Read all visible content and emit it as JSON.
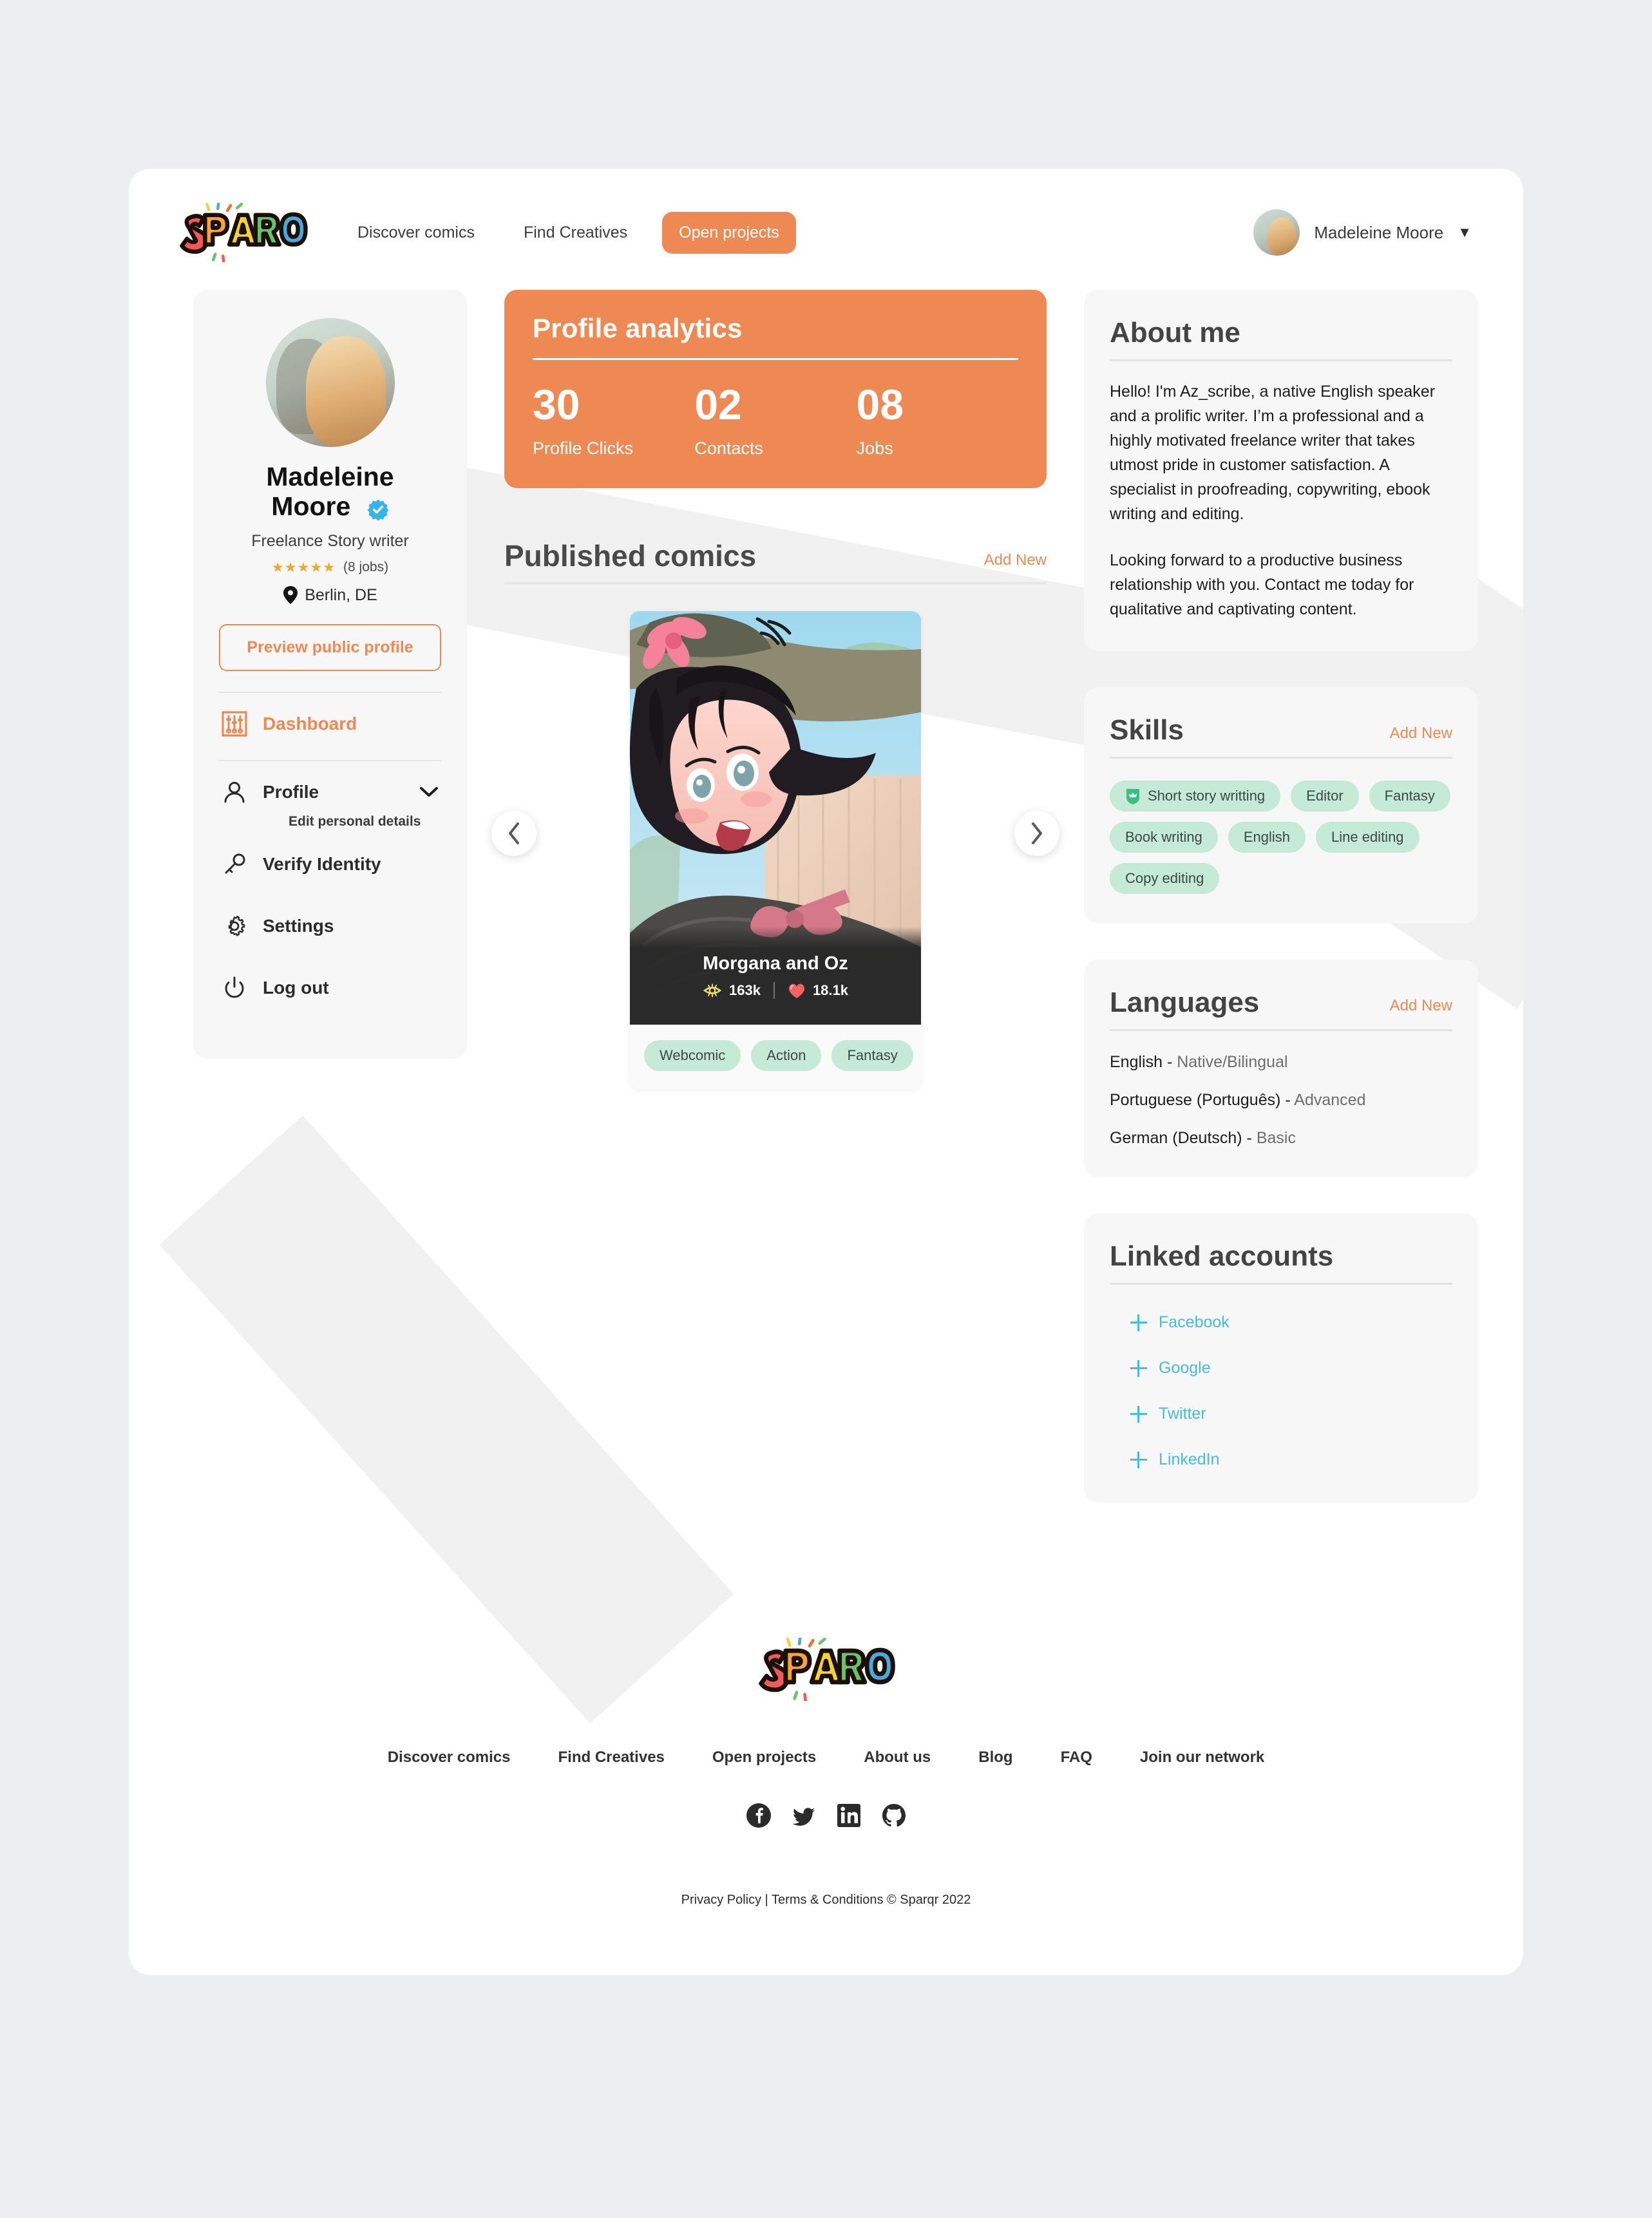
{
  "brand": {
    "name": "Sparqr"
  },
  "header": {
    "nav": [
      {
        "label": "Discover comics",
        "primary": false
      },
      {
        "label": "Find Creatives",
        "primary": false
      },
      {
        "label": "Open projects",
        "primary": true
      }
    ],
    "user": {
      "name": "Madeleine Moore",
      "caret": "▼"
    }
  },
  "sidebar": {
    "profile": {
      "name": "Madeleine Moore",
      "verified": true,
      "role": "Freelance Story writer",
      "stars": "★★★★★",
      "jobs": "(8 jobs)",
      "location": "Berlin, DE"
    },
    "preview_button": "Preview public profile",
    "nav": [
      {
        "label": "Dashboard",
        "icon": "dashboard-icon",
        "active": true
      },
      {
        "label": "Profile",
        "icon": "user-icon",
        "active": false,
        "sub": "Edit personal details",
        "expandable": true
      },
      {
        "label": "Verify Identity",
        "icon": "key-icon",
        "active": false
      },
      {
        "label": "Settings",
        "icon": "gear-icon",
        "active": false
      },
      {
        "label": "Log out",
        "icon": "power-icon",
        "active": false
      }
    ]
  },
  "analytics": {
    "title": "Profile analytics",
    "stats": [
      {
        "value": "30",
        "label": "Profile Clicks"
      },
      {
        "value": "02",
        "label": "Contacts"
      },
      {
        "value": "08",
        "label": "Jobs"
      }
    ]
  },
  "published": {
    "title": "Published comics",
    "add_new": "Add New",
    "prev_label": "‹",
    "next_label": "›",
    "comic": {
      "title": "Morgana and Oz",
      "views": "163k",
      "likes": "18.1k",
      "tags": [
        "Webcomic",
        "Action",
        "Fantasy"
      ]
    }
  },
  "about": {
    "title": "About me",
    "paragraphs": [
      "Hello! I'm Az_scribe, a native English speaker and a prolific writer. I’m a professional and a highly motivated freelance writer that takes utmost pride in customer satisfaction. A specialist in proofreading, copywriting, ebook writing and editing.",
      "Looking forward to a productive business relationship with you. Contact me today for qualitative and captivating content."
    ]
  },
  "skills": {
    "title": "Skills",
    "add_new": "Add New",
    "items": [
      {
        "label": "Short story writting",
        "badge": true
      },
      {
        "label": "Editor",
        "badge": false
      },
      {
        "label": "Fantasy",
        "badge": false
      },
      {
        "label": "Book writing",
        "badge": false
      },
      {
        "label": "English",
        "badge": false
      },
      {
        "label": "Line editing",
        "badge": false
      },
      {
        "label": "Copy editing",
        "badge": false
      }
    ]
  },
  "languages": {
    "title": "Languages",
    "add_new": "Add New",
    "items": [
      {
        "name": "English - ",
        "level": "Native/Bilingual"
      },
      {
        "name": "Portuguese (Português) - ",
        "level": "Advanced"
      },
      {
        "name": "German (Deutsch) - ",
        "level": "Basic"
      }
    ]
  },
  "linked_accounts": {
    "title": "Linked accounts",
    "items": [
      {
        "label": "Facebook"
      },
      {
        "label": "Google"
      },
      {
        "label": "Twitter"
      },
      {
        "label": "LinkedIn"
      }
    ]
  },
  "footer": {
    "nav": [
      "Discover comics",
      "Find Creatives",
      "Open projects",
      "About us",
      "Blog",
      "FAQ",
      "Join our network"
    ],
    "social": [
      "facebook-icon",
      "twitter-icon",
      "linkedin-icon",
      "github-icon"
    ],
    "legal": "Privacy Policy | Terms & Conditions © Sparqr 2022"
  },
  "colors": {
    "accent": "#ef8954",
    "page_bg": "#eceef1",
    "card_bg": "#ffffff",
    "panel_bg": "#f7f7f7",
    "chip_bg": "#c5ead7",
    "link_blue": "#45bbe0",
    "star": "#f5a623"
  }
}
